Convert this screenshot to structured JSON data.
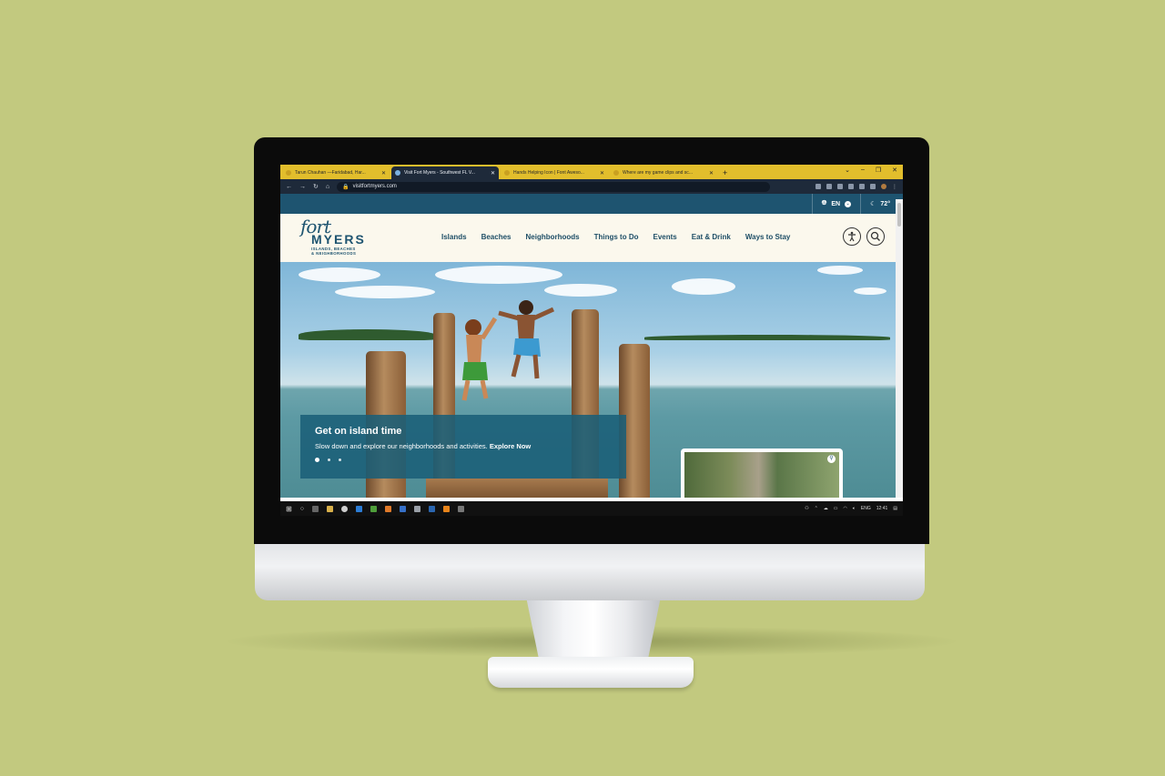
{
  "browser": {
    "tabs": [
      {
        "title": "Tarun Chauhan —Faridabad, Har...",
        "active": false
      },
      {
        "title": "Visit Fort Myers - Southwest FL V...",
        "active": true
      },
      {
        "title": "Hands Helping Icon | Font Aweso...",
        "active": false
      },
      {
        "title": "Where are my game clips and sc...",
        "active": false
      }
    ],
    "new_tab": "+",
    "url": "visitfortmyers.com"
  },
  "utility": {
    "language": "EN",
    "temperature": "72°"
  },
  "logo": {
    "script": "fort",
    "wordmark": "MYERS",
    "tagline_line1": "ISLANDS, BEACHES",
    "tagline_line2": "& NEIGHBORHOODS"
  },
  "nav": {
    "items": [
      "Islands",
      "Beaches",
      "Neighborhoods",
      "Things to Do",
      "Events",
      "Eat & Drink",
      "Ways to Stay"
    ]
  },
  "hero": {
    "title": "Get on island time",
    "body": "Slow down and explore our neighborhoods and activities.",
    "link": "Explore Now",
    "slides": 3,
    "active_slide": 1
  },
  "taskbar": {
    "language": "ENG",
    "time": "12:41"
  },
  "colors": {
    "background": "#c2c97f",
    "brand_blue": "#1e5470",
    "tab_bar": "#e2be2c",
    "nav_bg": "#fbf8ed"
  }
}
